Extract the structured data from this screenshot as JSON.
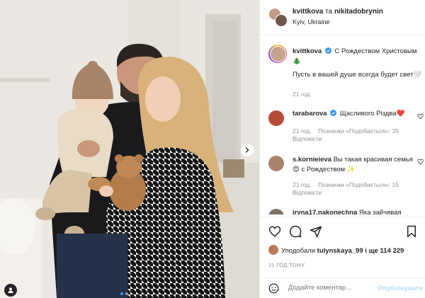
{
  "post": {
    "author": "kvittkova",
    "conj": "та",
    "coauthor": "nikitadobrynin",
    "location": "Kyiv, Ukraine"
  },
  "caption": {
    "username": "kvittkova",
    "text1": "С Рождеством Христовым",
    "tree": "🎄",
    "text2": "Пусть в вашей душе всегда будет свет🤍",
    "time": "21 год."
  },
  "comments": [
    {
      "username": "tarabarova",
      "text": "Щасливого Різдва",
      "heart": "❤️",
      "time": "21 год.",
      "likes": "Позначки «Подобається»: 35",
      "reply": "Відповісти"
    },
    {
      "username": "s.kornieieva",
      "text": "Вы такая красивая семья",
      "emoji": "😍",
      "text_after": "с Рождеством",
      "emoji2": "✨",
      "time": "21 год.",
      "likes": "Позначки «Подобається»: 15",
      "reply": "Відповісти"
    },
    {
      "username": "iryna17.nakonechna",
      "text": "Яка зайчявая"
    }
  ],
  "likes": {
    "prefix": "Уподобали",
    "user": "tulynskaya_99",
    "suffix": "і ще 114 229"
  },
  "post_time": "21 ГОД ТОМУ",
  "add_comment": {
    "placeholder": "Додайте коментар...",
    "publish": "Опублікувати"
  },
  "icons": {
    "like": "heart-icon",
    "comment": "comment-icon",
    "share": "paper-plane-icon",
    "save": "bookmark-icon",
    "emoji": "smiley-icon",
    "next": "chevron-right-icon",
    "tag": "user-tag-icon",
    "verified": "verified-badge-icon"
  },
  "colors": {
    "link_blue": "#0095f6",
    "publish_disabled": "#b2dffc",
    "verified": "#3897f0",
    "meta_gray": "#8e8e8e"
  }
}
